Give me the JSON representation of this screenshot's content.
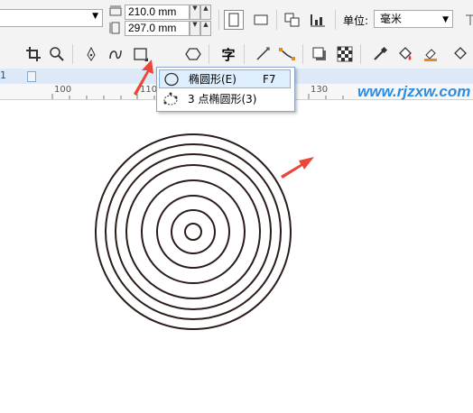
{
  "property_bar": {
    "width_value": "210.0 mm",
    "height_value": "297.0 mm",
    "units_label": "单位:",
    "units_value": "毫米"
  },
  "tabs": {
    "first_tab": "1"
  },
  "ruler": {
    "ticks": [
      "100",
      "110",
      "130"
    ]
  },
  "flyout": {
    "items": [
      {
        "label": "椭圆形(E)",
        "shortcut": "F7"
      },
      {
        "label": "3 点椭圆形(3)",
        "shortcut": ""
      }
    ]
  },
  "watermark": "www.rjzxw.com",
  "colors": {
    "arrow": "#e9473a",
    "circle_stroke": "#2a1d1a",
    "accent": "#3c78c3"
  },
  "icons": [
    "crop-icon",
    "zoom-icon",
    "pen-icon",
    "curve-icon",
    "rectangle-icon",
    "ellipse-icon",
    "polygon-icon",
    "text-icon",
    "line-icon",
    "connector-icon",
    "drop-shadow-icon",
    "transparency-icon",
    "eyedropper-icon",
    "fill-icon",
    "outline-fill-icon"
  ]
}
